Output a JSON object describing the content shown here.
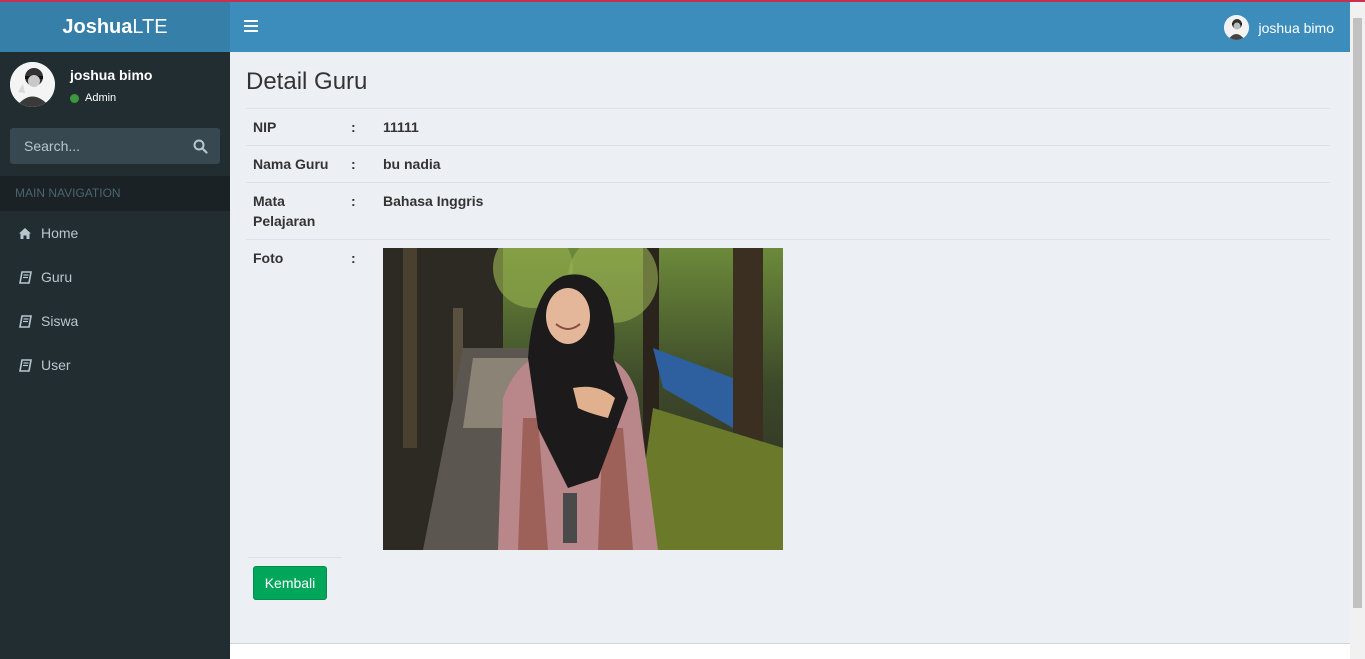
{
  "logo": {
    "bold": "Joshua",
    "light": "LTE"
  },
  "navbar": {
    "user_name": "joshua bimo"
  },
  "sidebar": {
    "user_name": "joshua bimo",
    "user_role": "Admin",
    "search_placeholder": "Search...",
    "nav_header": "MAIN NAVIGATION",
    "items": [
      {
        "label": "Home",
        "icon": "home-icon"
      },
      {
        "label": "Guru",
        "icon": "book-icon"
      },
      {
        "label": "Siswa",
        "icon": "book-icon"
      },
      {
        "label": "User",
        "icon": "book-icon"
      }
    ]
  },
  "content": {
    "title": "Detail Guru",
    "rows": [
      {
        "label": "NIP",
        "sep": ":",
        "value": "11111"
      },
      {
        "label": "Nama Guru",
        "sep": ":",
        "value": "bu nadia"
      },
      {
        "label": "Mata Pelajaran",
        "sep": ":",
        "value": "Bahasa Inggris"
      },
      {
        "label": "Foto",
        "sep": ":"
      }
    ],
    "back_button": "Kembali"
  },
  "colors": {
    "header": "#3c8dbc",
    "logo_bg": "#367fa9",
    "sidebar": "#222d32",
    "button": "#00a65a"
  }
}
